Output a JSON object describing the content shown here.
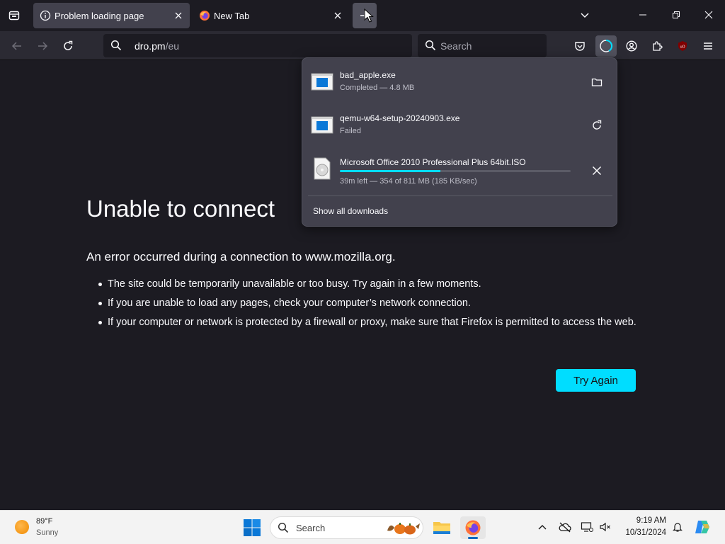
{
  "tabs": [
    {
      "title": "Problem loading page",
      "active": true
    },
    {
      "title": "New Tab",
      "active": false
    }
  ],
  "urlbar": {
    "host": "dro.pm",
    "path": "/eu"
  },
  "searchbar": {
    "placeholder": "Search"
  },
  "error": {
    "title": "Unable to connect",
    "description": "An error occurred during a connection to www.mozilla.org.",
    "bullets": [
      "The site could be temporarily unavailable or too busy. Try again in a few moments.",
      "If you are unable to load any pages, check your computer’s network connection.",
      "If your computer or network is protected by a firewall or proxy, make sure that Firefox is permitted to access the web."
    ],
    "button": "Try Again"
  },
  "downloads": {
    "items": [
      {
        "name": "bad_apple.exe",
        "status": "Completed — 4.8 MB",
        "action": "folder-icon"
      },
      {
        "name": "qemu-w64-setup-20240903.exe",
        "status": "Failed",
        "action": "retry-icon"
      },
      {
        "name": "Microsoft Office 2010 Professional Plus 64bit.ISO",
        "status": "39m left — 354 of 811 MB (185 KB/sec)",
        "progress": 0.436,
        "action": "cancel-icon"
      }
    ],
    "show_all": "Show all downloads"
  },
  "taskbar": {
    "weather": {
      "temp": "89°F",
      "condition": "Sunny"
    },
    "search_placeholder": "Search",
    "clock": {
      "time": "9:19 AM",
      "date": "10/31/2024"
    }
  },
  "colors": {
    "accent": "#00ddff",
    "page_bg": "#1c1b22",
    "panel_bg": "#42414d"
  }
}
